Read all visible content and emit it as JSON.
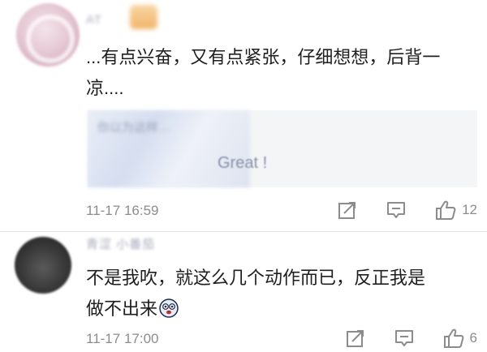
{
  "comments": [
    {
      "username": "AT",
      "text_line1": "...有点兴奋，又有点紧张，仔细想想，后背一",
      "text_line2": "凉....",
      "quote": {
        "title": "你以为这样…",
        "subtitle": "Great !"
      },
      "time": "11-17 16:59",
      "likes": "12"
    },
    {
      "username": "青涩 小番茄",
      "text_line1": "不是我吹，就这么几个动作而已，反正我是",
      "text_line2": "做不出来",
      "time": "11-17 17:00",
      "likes": "6"
    }
  ],
  "icons": {
    "share": "share-icon",
    "reply": "reply-icon",
    "like": "thumbs-up-icon",
    "emoji": "dizzy-face-emoji-icon"
  },
  "colors": {
    "text": "#1f1f1f",
    "meta": "#8c8c8c",
    "quote_bg": "#f4f5f7"
  }
}
